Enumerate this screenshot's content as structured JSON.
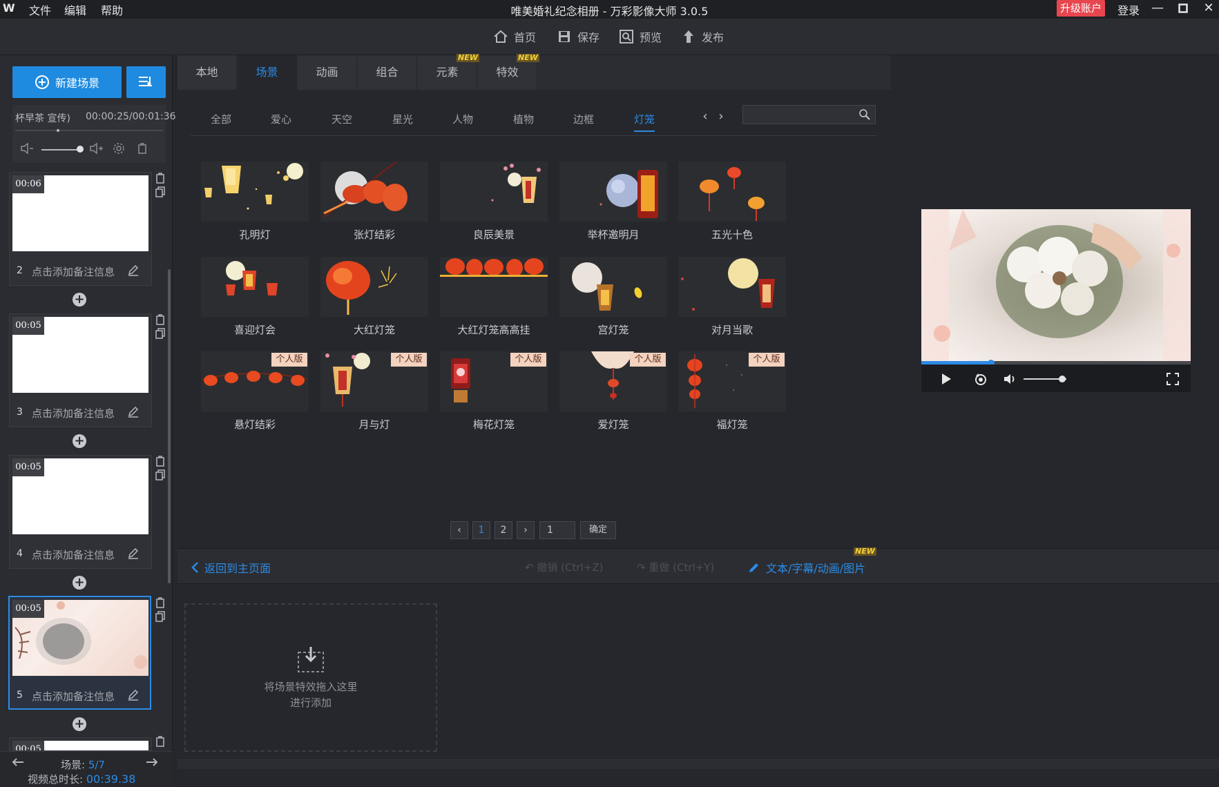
{
  "app": {
    "logo": "W",
    "menu": [
      "文件",
      "编辑",
      "帮助"
    ],
    "title": "唯美婚礼纪念相册 - 万彩影像大师 3.0.5",
    "upgrade": "升级账户",
    "login": "登录"
  },
  "toolbar": {
    "home": "首页",
    "save": "保存",
    "preview": "预览",
    "publish": "发布"
  },
  "left": {
    "new_scene": "新建场景",
    "music_name": "杯早茶 宣传)",
    "music_time": "00:00:25/00:01:36",
    "scenes": [
      {
        "time": "00:06",
        "num": "2",
        "note": "点击添加备注信息"
      },
      {
        "time": "00:05",
        "num": "3",
        "note": "点击添加备注信息"
      },
      {
        "time": "00:05",
        "num": "4",
        "note": "点击添加备注信息"
      },
      {
        "time": "00:05",
        "num": "5",
        "note": "点击添加备注信息"
      },
      {
        "time": "00:05"
      }
    ],
    "scene_label": "场景: ",
    "scene_pos": "5/7",
    "total_label": "视频总时长: ",
    "total_time": "00:39.38"
  },
  "library": {
    "tabs": [
      "本地",
      "场景",
      "动画",
      "组合",
      "元素",
      "特效"
    ],
    "new_tag": "NEW",
    "categories": [
      "全部",
      "爱心",
      "天空",
      "星光",
      "人物",
      "植物",
      "边框",
      "灯笼"
    ],
    "pro_tag": "个人版",
    "items": [
      "孔明灯",
      "张灯结彩",
      "良辰美景",
      "举杯邀明月",
      "五光十色",
      "喜迎灯会",
      "大红灯笼",
      "大红灯笼高高挂",
      "宫灯笼",
      "对月当歌",
      "悬灯结彩",
      "月与灯",
      "梅花灯笼",
      "爱灯笼",
      "福灯笼"
    ],
    "pages": [
      "1",
      "2"
    ],
    "page_input": "1",
    "confirm": "确定"
  },
  "actions": {
    "back": "返回到主页面",
    "undo": "撤销 (Ctrl+Z)",
    "redo": "重做 (Ctrl+Y)",
    "text_link": "文本/字幕/动画/图片"
  },
  "drop": {
    "line1": "将场景特效拖入这里",
    "line2": "进行添加"
  },
  "player": {
    "progress": 0.26,
    "volume": 0.9
  },
  "colors": {
    "accent": "#2c8be6",
    "upgrade": "#e8464f",
    "pro_tag": "#f3d2c0"
  }
}
